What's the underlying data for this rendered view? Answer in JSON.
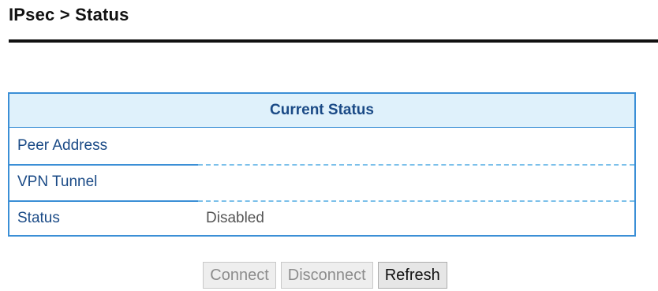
{
  "page": {
    "title": "IPsec > Status"
  },
  "status_table": {
    "header": "Current Status",
    "rows": [
      {
        "label": "Peer Address",
        "value": ""
      },
      {
        "label": "VPN Tunnel",
        "value": ""
      },
      {
        "label": "Status",
        "value": "Disabled"
      }
    ]
  },
  "buttons": {
    "connect": {
      "label": "Connect",
      "enabled": false
    },
    "disconnect": {
      "label": "Disconnect",
      "enabled": false
    },
    "refresh": {
      "label": "Refresh",
      "enabled": true
    }
  },
  "colors": {
    "accent": "#3b8fd6",
    "header_bg": "#dff1fb",
    "label_text": "#1a4a86"
  }
}
